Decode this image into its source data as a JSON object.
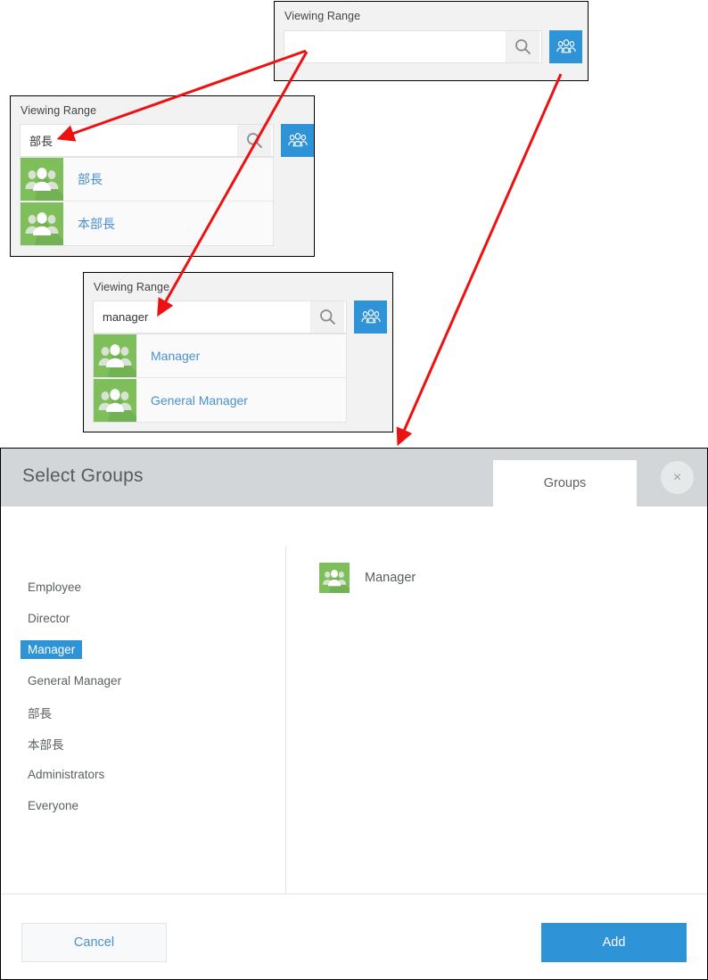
{
  "colors": {
    "accent_blue": "#2f93d8",
    "link_blue": "#4b8fd0",
    "avatar_green": "#7ebe5b",
    "dialog_header_grey": "#d2d6d8",
    "arrow_red": "#ee1111",
    "panel_bg": "#f2f2f2"
  },
  "panels": [
    {
      "label": "Viewing Range",
      "input_value": "",
      "input_placeholder": "",
      "search_icon": "search-icon",
      "group_button_icon": "group-people-icon",
      "suggestions": []
    },
    {
      "label": "Viewing Range",
      "input_value": "部長",
      "input_placeholder": "",
      "search_icon": "search-icon",
      "group_button_icon": "group-people-icon",
      "suggestions": [
        {
          "icon": "group-avatar-icon",
          "name": "部長"
        },
        {
          "icon": "group-avatar-icon",
          "name": "本部長"
        }
      ]
    },
    {
      "label": "Viewing Range",
      "input_value": "manager",
      "input_placeholder": "",
      "search_icon": "search-icon",
      "group_button_icon": "group-people-icon",
      "suggestions": [
        {
          "icon": "group-avatar-icon",
          "name": "Manager"
        },
        {
          "icon": "group-avatar-icon",
          "name": "General Manager"
        }
      ]
    }
  ],
  "dialog": {
    "title": "Select Groups",
    "tab_label": "Groups",
    "close_label": "×",
    "group_list": [
      {
        "label": "Employee",
        "selected": false
      },
      {
        "label": "Director",
        "selected": false
      },
      {
        "label": "Manager",
        "selected": true
      },
      {
        "label": "General Manager",
        "selected": false
      },
      {
        "label": "部長",
        "selected": false
      },
      {
        "label": "本部長",
        "selected": false
      },
      {
        "label": "Administrators",
        "selected": false
      },
      {
        "label": "Everyone",
        "selected": false
      }
    ],
    "selected_items": [
      {
        "icon": "group-avatar-icon",
        "name": "Manager"
      }
    ],
    "cancel_label": "Cancel",
    "add_label": "Add"
  }
}
